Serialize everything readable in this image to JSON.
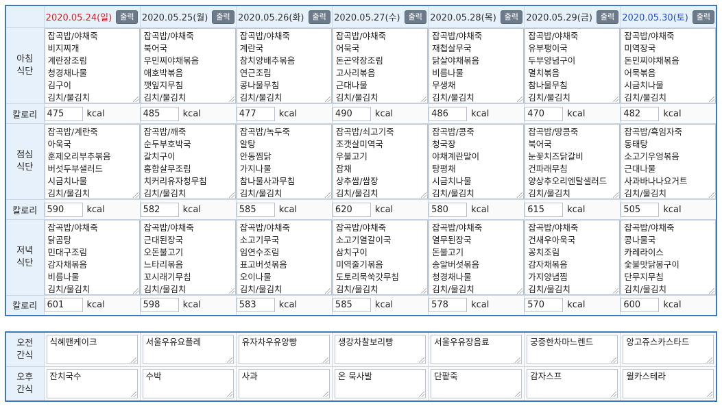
{
  "days": [
    {
      "date": "2020.05.24(일)",
      "kind": "sun"
    },
    {
      "date": "2020.05.25(월)",
      "kind": "weekday"
    },
    {
      "date": "2020.05.26(화)",
      "kind": "weekday"
    },
    {
      "date": "2020.05.27(수)",
      "kind": "weekday"
    },
    {
      "date": "2020.05.28(목)",
      "kind": "weekday"
    },
    {
      "date": "2020.05.29(금)",
      "kind": "weekday"
    },
    {
      "date": "2020.05.30(토)",
      "kind": "sat"
    }
  ],
  "print_label": "출력",
  "calorie_label": "칼로리",
  "unit": "kcal",
  "colors": {
    "sunday": "#d62020",
    "saturday": "#1f4fd1",
    "border_accent": "#3a78c0",
    "header_bg": "#e7f1fb"
  },
  "meals": [
    {
      "label": [
        "아침",
        "식단"
      ],
      "menus": [
        [
          "잡곡밥/야채죽",
          "비지찌개",
          "계란장조림",
          "청경채나물",
          "김구이",
          "김치/물김치"
        ],
        [
          "잡곡밥/야채죽",
          "북어국",
          "우민찌야채볶음",
          "애호박볶음",
          "깻잎지무침",
          "김치/물김치"
        ],
        [
          "잡곡밥/야채죽",
          "계란국",
          "참치양배추볶음",
          "연근조림",
          "콩나물무침",
          "김치/물김치"
        ],
        [
          "잡곡밥/야채죽",
          "어묵국",
          "돈곤약장조림",
          "고사리볶음",
          "근대나물",
          "김치/물김치"
        ],
        [
          "잡곡밥/야채죽",
          "재첩살무국",
          "닭살야채볶음",
          "비름나물",
          "무생채",
          "김치/물김치"
        ],
        [
          "잡곡밥/야채죽",
          "유부팽이국",
          "두부양념구이",
          "멸치볶음",
          "참나물무침",
          "김치/물김치"
        ],
        [
          "잡곡밥/야채죽",
          "미역장국",
          "돈민찌야채볶음",
          "어묵볶음",
          "시금치나물",
          "김치/물김치"
        ]
      ],
      "calories": [
        "475",
        "485",
        "477",
        "490",
        "486",
        "470",
        "482"
      ]
    },
    {
      "label": [
        "점심",
        "식단"
      ],
      "menus": [
        [
          "잡곡밥/계란죽",
          "아욱국",
          "훈제오리부추볶음",
          "버섯두부샐러드",
          "시금치나물",
          "김치/물김치"
        ],
        [
          "잡곡밥/깨죽",
          "순두부호박국",
          "갈치구이",
          "홍합살무조림",
          "치커리유자청무침",
          "김치/물김치"
        ],
        [
          "잡곡밥/녹두죽",
          "알탕",
          "안동찜닭",
          "가지나물",
          "참나물사과무침",
          "김치/물김치"
        ],
        [
          "잡곡밥/쇠고기죽",
          "조갯살미역국",
          "우불고기",
          "잡채",
          "상추쌈/쌈장",
          "김치/물김치"
        ],
        [
          "잡곡밥/콩죽",
          "청국장",
          "야채계란말이",
          "탕평채",
          "시금치나물",
          "김치/물김치"
        ],
        [
          "잡곡밥/땅콩죽",
          "북어국",
          "눈꽃치즈닭갈비",
          "건파래무침",
          "양상추오리엔탈샐러드",
          "김치/물김치"
        ],
        [
          "잡곡밥/흑임자죽",
          "동태탕",
          "소고기우엉볶음",
          "근대나물",
          "사과바나나요거트",
          "김치/물김치"
        ]
      ],
      "calories": [
        "590",
        "582",
        "585",
        "620",
        "580",
        "615",
        "505"
      ]
    },
    {
      "label": [
        "저녁",
        "식단"
      ],
      "menus": [
        [
          "잡곡밥/야채죽",
          "닭곰탕",
          "민대구조림",
          "감자채볶음",
          "비름나물",
          "김치/물김치"
        ],
        [
          "잡곡밥/야채죽",
          "근대된장국",
          "오돈불고기",
          "느타리볶음",
          "꼬시래기무침",
          "김치/물김치"
        ],
        [
          "잡곡밥/야채죽",
          "소고기무국",
          "임연수조림",
          "표고버섯볶음",
          "오이나물",
          "김치/물김치"
        ],
        [
          "잡곡밥/야채죽",
          "소고기열갈이국",
          "삼치구이",
          "미역줄기볶음",
          "도토리묵쑥갓무침",
          "김치/물김치"
        ],
        [
          "잡곡밥/야채죽",
          "열무된장국",
          "돈불고기",
          "송알버섯볶음",
          "청경채나물",
          "김치/물김치"
        ],
        [
          "잡곡밥/야채죽",
          "건새우아욱국",
          "꽁치조림",
          "감자채볶음",
          "가지양념찜",
          "김치/물김치"
        ],
        [
          "잡곡밥/야채죽",
          "콩나물국",
          "카레라이스",
          "숯불맛닭봉구이",
          "단무지무침",
          "김치/물김치"
        ]
      ],
      "calories": [
        "601",
        "598",
        "583",
        "585",
        "578",
        "570",
        "600"
      ]
    }
  ],
  "snacks": [
    {
      "label": [
        "오전",
        "간식"
      ],
      "items": [
        [
          "식혜",
          "팬케이크"
        ],
        [
          "서울우유",
          "요플레"
        ],
        [
          "유자차",
          "우유앙빵"
        ],
        [
          "생강차",
          "찰보리빵"
        ],
        [
          "서울우유",
          "장음료"
        ],
        [
          "궁중한차",
          "마느렌드"
        ],
        [
          "앙고쥬스",
          "카스타드"
        ]
      ]
    },
    {
      "label": [
        "오후",
        "간식"
      ],
      "items": [
        [
          "잔치국수"
        ],
        [
          "수박"
        ],
        [
          "사과"
        ],
        [
          "온 묵사발"
        ],
        [
          "단팥죽"
        ],
        [
          "감자스프"
        ],
        [
          "윌",
          "카스테라"
        ]
      ]
    }
  ]
}
